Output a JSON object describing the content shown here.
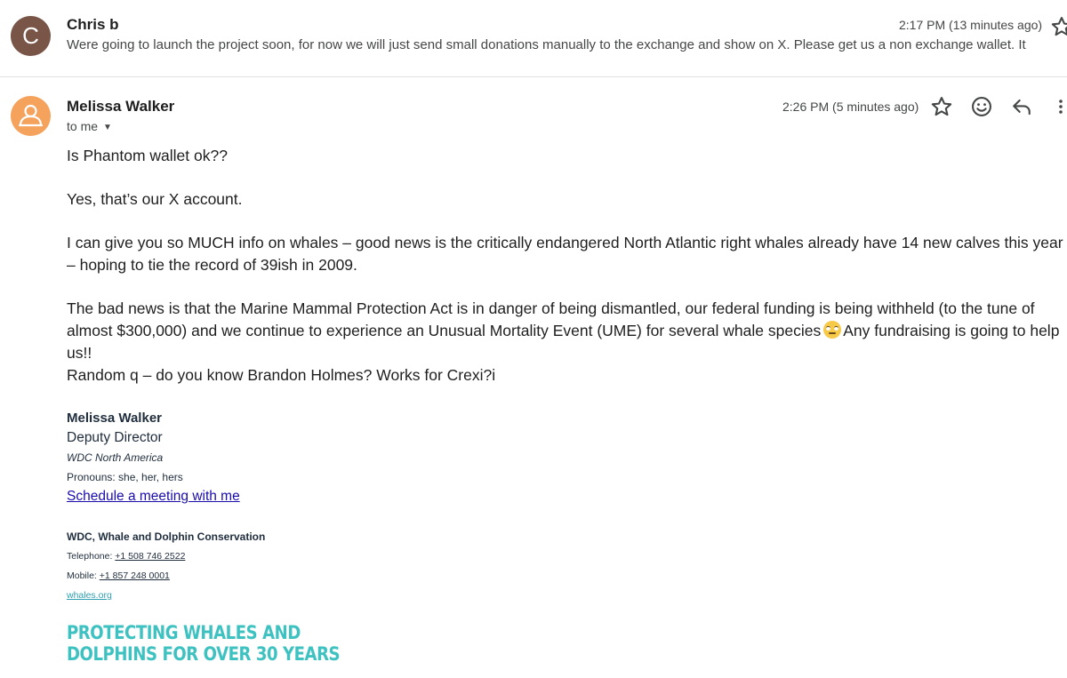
{
  "collapsed_message": {
    "avatar_letter": "C",
    "sender": "Chris b",
    "time": "2:17 PM (13 minutes ago)",
    "snippet": "Were going to launch the project soon, for now we will just send small donations manually to the exchange and show on X. Please get us a non exchange wallet. It"
  },
  "expanded_message": {
    "sender": "Melissa Walker",
    "recipient_label": "to me",
    "time": "2:26 PM (5 minutes ago)",
    "icons": [
      "star-icon",
      "emoji-reaction-icon",
      "reply-icon",
      "more-vert-icon"
    ],
    "body": {
      "p1": "Is Phantom wallet ok??",
      "p2": "Yes, that’s our X account.",
      "p3": "I can give you so MUCH info on whales – good news is the critically endangered North Atlantic right whales already have 14 new calves this year – hoping to tie the record of 39ish in 2009.",
      "p4_before_emoji": "The bad news is that the Marine Mammal Protection Act is in danger of being dismantled, our federal funding is being withheld (to the tune of almost $300,000) and we continue to experience an Unusual Mortality Event (UME) for several whale species",
      "p4_after_emoji": "Any fundraising is going to help us!!",
      "p5": "Random q – do you know Brandon Holmes? Works for Crexi?i"
    },
    "signature": {
      "name": "Melissa Walker",
      "title": "Deputy Director",
      "org": "WDC North America",
      "pronouns": "Pronouns: she, her, hers",
      "meeting_link": "Schedule a meeting with me",
      "company": "WDC, Whale and Dolphin Conservation",
      "telephone_label": "Telephone: ",
      "telephone": "+1 508 746 2522",
      "mobile_label": "Mobile: ",
      "mobile": "+1 857 248 0001",
      "website": "whales.org",
      "banner_line1": "PROTECTING WHALES AND",
      "banner_line2": "DOLPHINS FOR OVER 30 YEARS"
    }
  },
  "colors": {
    "avatar_c": "#795548",
    "avatar_m": "#f5a25d",
    "link": "#1a0dab",
    "banner": "#3ec2c1"
  }
}
